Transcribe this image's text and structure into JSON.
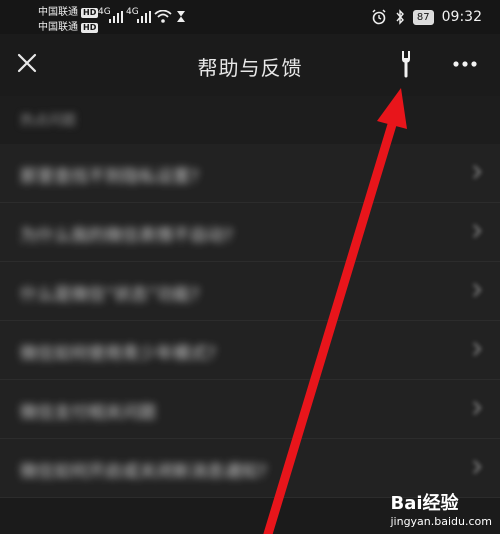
{
  "status_bar": {
    "carrier1": "中国联通",
    "carrier2": "中国联通",
    "hd1": "HD",
    "hd2": "HD",
    "net1": "4G",
    "net2": "4G",
    "battery": "87",
    "time": "09:32"
  },
  "appbar": {
    "title": "帮助与反馈"
  },
  "list": {
    "section_header": "热点问题",
    "items": [
      {
        "label": "那里查找不到隐私设置?"
      },
      {
        "label": "为什么我的微信表情不自动?"
      },
      {
        "label": "什么是微信“状态”功能?"
      },
      {
        "label": "微信如何使用青少年模式?"
      },
      {
        "label": "微信支付相关问题"
      },
      {
        "label": "微信如何开启或关闭新消息通知?"
      }
    ]
  },
  "watermark": {
    "brand": "Bai经验",
    "site": "jingyan.baidu.com"
  },
  "colors": {
    "arrow": "#e8151b",
    "background": "#1b1b1b"
  }
}
